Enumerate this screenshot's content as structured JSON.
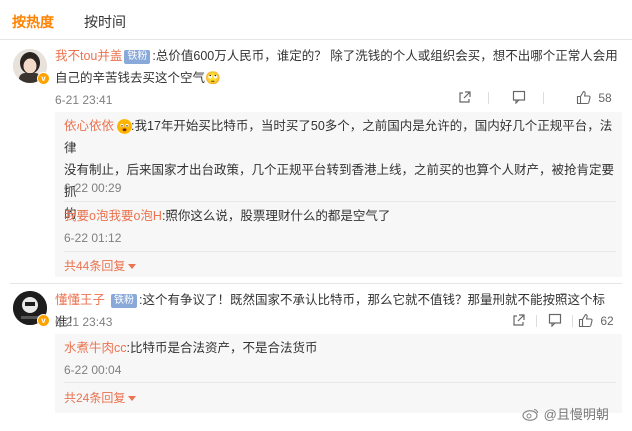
{
  "tabs": {
    "hot": "按热度",
    "time": "按时间"
  },
  "comments": [
    {
      "user": "我不tou并盖",
      "badge": "铁粉",
      "line1": ":总价值600万人民币，谁定的？ 除了洗钱的个人或组织会买，想不出哪个正常人会用",
      "line2": "自己的辛苦钱去买这个空气",
      "emoji": "🙄",
      "time": "6-21 23:41",
      "likes": "58",
      "replies": [
        {
          "user": "依心依依",
          "line1": ":我17年开始买比特币，当时买了50多个，之前国内是允许的，国内好几个正规平台，法律",
          "line2": "没有制止，后来国家才出台政策，几个正规平台转到香港上线，之前买的也算个人财产，被抢肯定要抓",
          "line3": "的",
          "time": "6-22 00:29"
        },
        {
          "user": "我要o泡我要o泡H",
          "text": ":照你这么说，股票理财什么的都是空气了",
          "time": "6-22 01:12"
        }
      ],
      "more_replies": "共44条回复"
    },
    {
      "user": "懂懂王子",
      "badge": "铁粉",
      "text": ":这个有争议了！既然国家不承认比特币，那么它就不值钱？那量刑就不能按照这个标准！",
      "time": "6-21 23:43",
      "likes": "62",
      "replies": [
        {
          "user": "水煮牛肉cc",
          "text": ":比特币是合法资产，不是合法货币",
          "time": "6-22 00:04"
        }
      ],
      "more_replies": "共24条回复"
    }
  ],
  "watermark": "@且慢明朝",
  "colors": {
    "accent": "#ff8200",
    "username": "#eb7350",
    "badge": "#89a9d9"
  }
}
